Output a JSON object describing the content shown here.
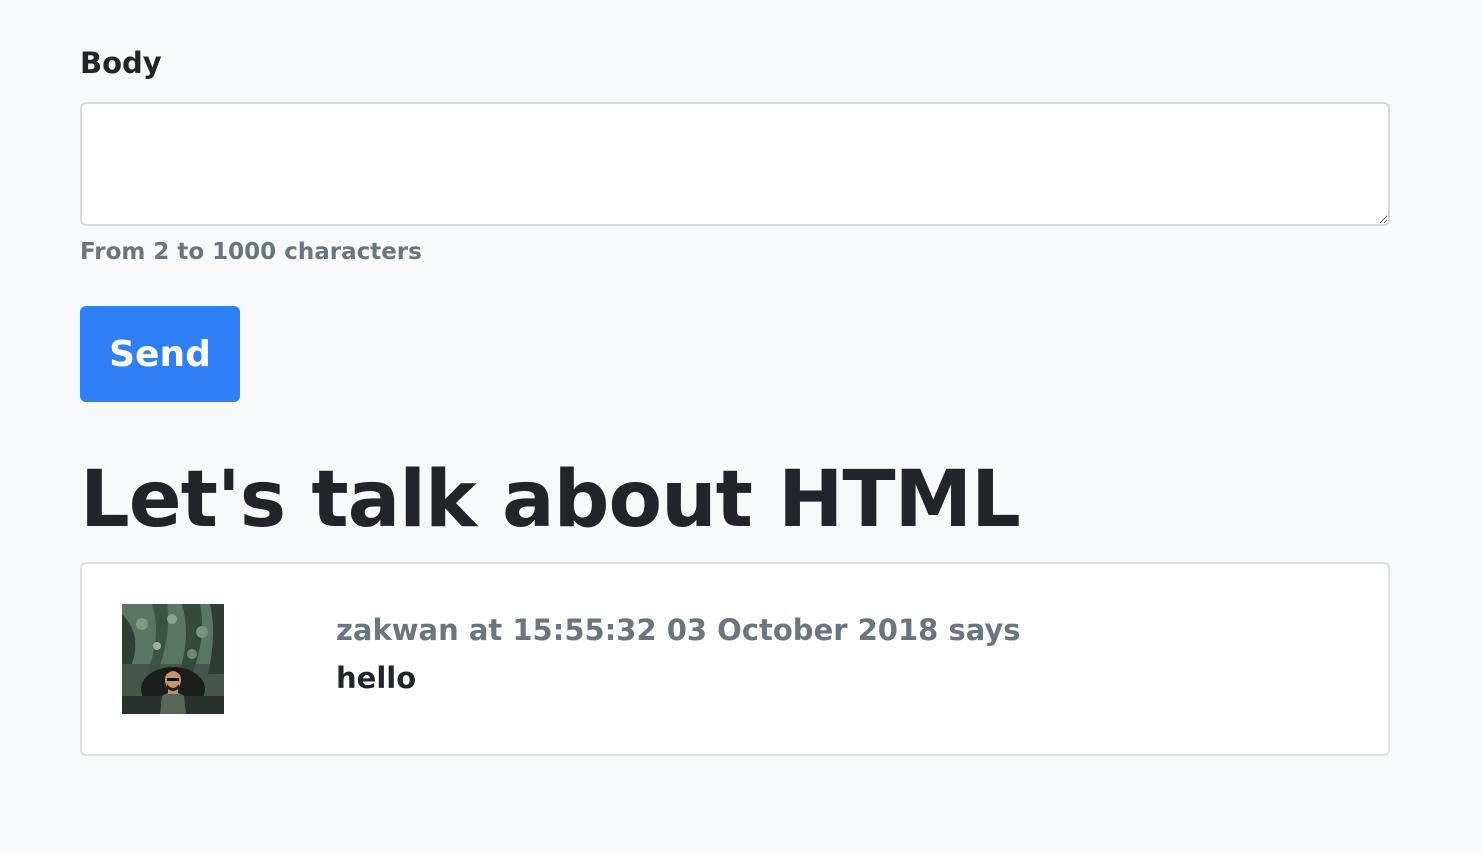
{
  "form": {
    "label": "Body",
    "textarea_value": "",
    "textarea_placeholder": "",
    "help_text": "From 2 to 1000 characters",
    "send_label": "Send"
  },
  "thread": {
    "title": "Let's talk about HTML"
  },
  "comments": [
    {
      "author": "zakwan",
      "meta": "zakwan at 15:55:32 03 October 2018 says",
      "body": "hello",
      "avatar": "user-photo"
    }
  ],
  "colors": {
    "background": "#f8f9fa",
    "primary": "#2e7ff6",
    "text": "#212529",
    "muted": "#6c757d",
    "border": "#d6d9dc"
  }
}
